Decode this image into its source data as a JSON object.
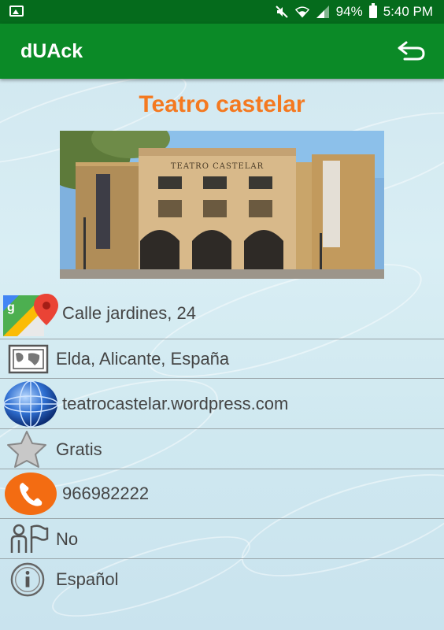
{
  "status_bar": {
    "battery_percent": "94%",
    "time": "5:40 PM",
    "icons": [
      "image-icon",
      "mute-icon",
      "wifi-icon",
      "signal-icon",
      "battery-icon"
    ]
  },
  "app_bar": {
    "title": "dUAck",
    "back_icon": "back-arrow-icon"
  },
  "place": {
    "title": "Teatro castelar",
    "photo_sign": "TEATRO CASTELAR"
  },
  "details": [
    {
      "icon": "google-maps-icon",
      "text": "Calle jardines, 24"
    },
    {
      "icon": "map-icon",
      "text": "Elda, Alicante, España"
    },
    {
      "icon": "globe-icon",
      "text": "teatrocastelar.wordpress.com"
    },
    {
      "icon": "star-icon",
      "text": "Gratis"
    },
    {
      "icon": "phone-icon",
      "text": "966982222"
    },
    {
      "icon": "accessibility-icon",
      "text": "No"
    },
    {
      "icon": "info-icon",
      "text": "Español"
    }
  ],
  "colors": {
    "status_bar": "#056b1c",
    "app_bar": "#0b8a27",
    "title": "#f47920",
    "phone_badge": "#f36c12"
  }
}
